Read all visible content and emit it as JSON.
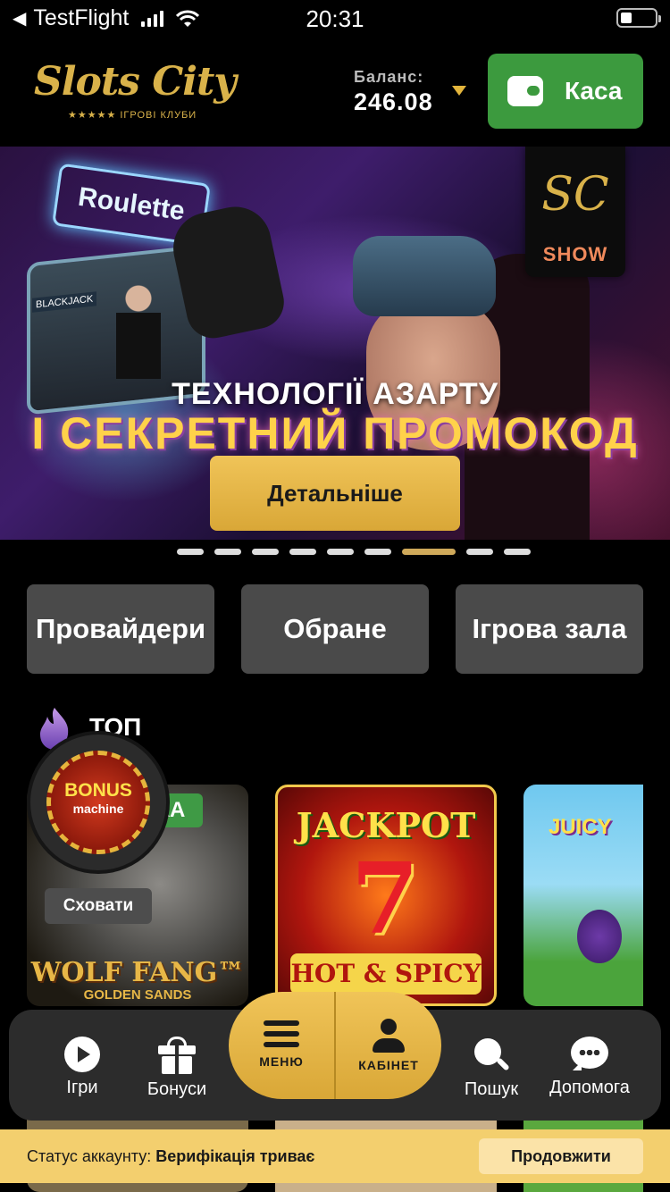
{
  "status_bar": {
    "back_app": "TestFlight",
    "time": "20:31"
  },
  "header": {
    "logo_text": "Slots City",
    "logo_subtitle": "★★★★★ ІГРОВІ КЛУБИ",
    "balance_label": "Баланс:",
    "balance_value": "246.08",
    "cashier_label": "Каса"
  },
  "banner": {
    "headline": "ТЕХНОЛОГІЇ АЗАРТУ",
    "subheadline": "І СЕКРЕТНИЙ ПРОМОКОД",
    "cta_label": "Детальніше",
    "badge_text": "SHOW",
    "badge_mark": "SC",
    "sign_text": "Roulette",
    "table_tag": "BLACKJACK"
  },
  "carousel": {
    "count": 9,
    "active_index": 6
  },
  "categories": [
    {
      "label": "Провайдери"
    },
    {
      "label": "Обране"
    },
    {
      "label": "Ігрова зала"
    }
  ],
  "top_section": {
    "title": "ТОП"
  },
  "games": [
    {
      "title": "WOLF FANG™",
      "subtitle": "GOLDEN SANDS",
      "badge": "НКА"
    },
    {
      "title": "JACKPOT",
      "subtitle": "HOT & SPICY",
      "symbol": "7"
    },
    {
      "title": "JUICY"
    }
  ],
  "bonus_machine": {
    "line1": "BONUS",
    "line2": "machine",
    "hide_label": "Сховати"
  },
  "bottom_nav": {
    "games": "Ігри",
    "bonuses": "Бонуси",
    "menu": "МЕНЮ",
    "cabinet": "КАБІНЕТ",
    "search": "Пошук",
    "help": "Допомога"
  },
  "verification": {
    "label": "Статус аккаунту:",
    "status": "Верифікація триває",
    "button": "Продовжити"
  },
  "colors": {
    "gold": "#d9a737",
    "green": "#3c9a3e",
    "banner_yellow": "#f3cf6e"
  }
}
